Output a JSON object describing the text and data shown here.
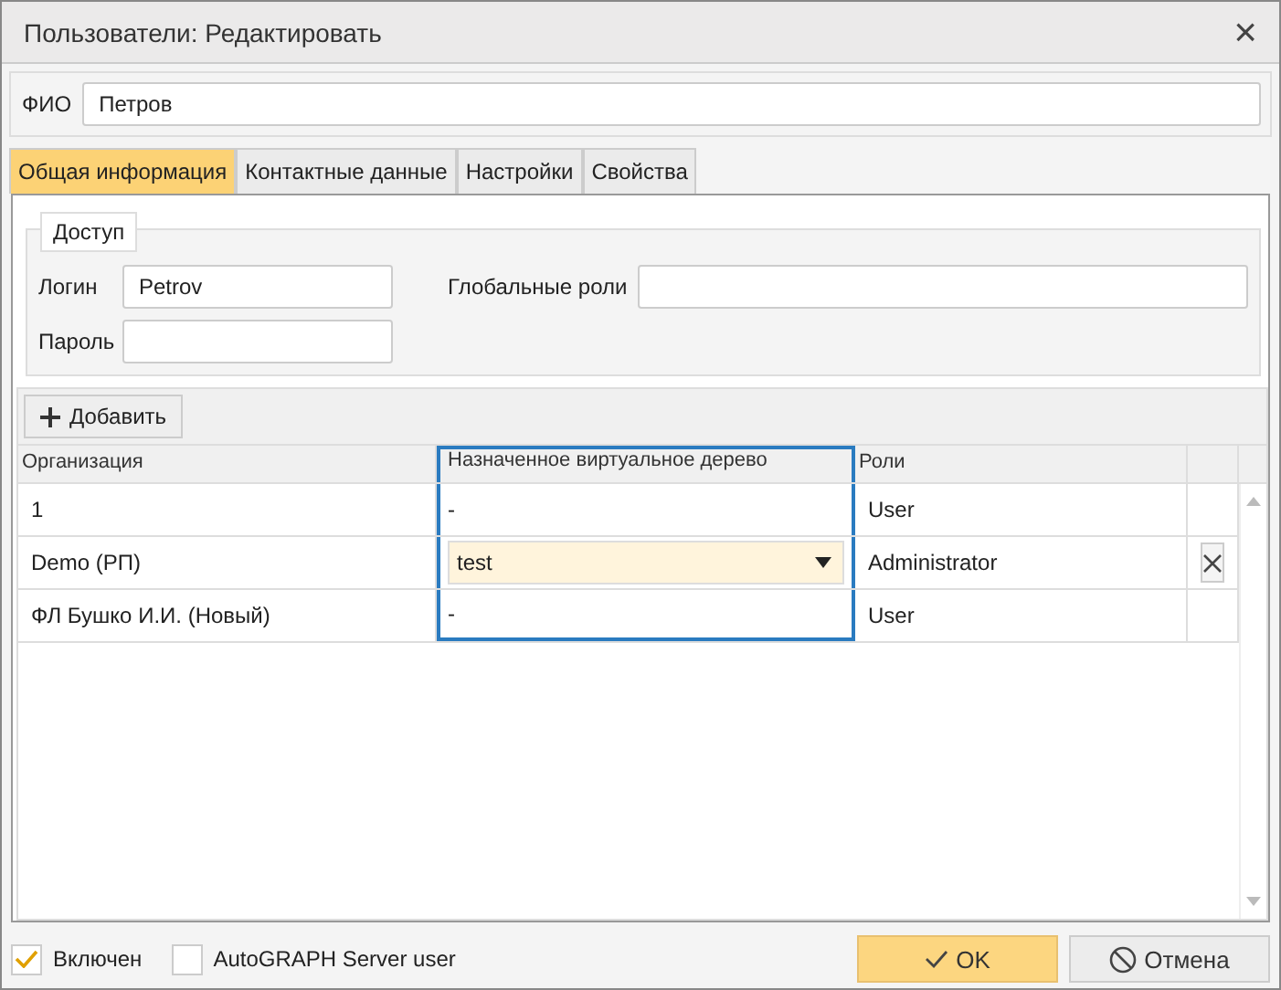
{
  "window": {
    "title": "Пользователи: Редактировать",
    "close": "×"
  },
  "fio": {
    "label": "ФИО",
    "value": "Петров"
  },
  "tabs": [
    {
      "label": "Общая информация",
      "selected": true
    },
    {
      "label": "Контактные данные",
      "selected": false
    },
    {
      "label": "Настройки",
      "selected": false
    },
    {
      "label": "Свойства",
      "selected": false
    }
  ],
  "access": {
    "legend": "Доступ",
    "login_label": "Логин",
    "login": "Petrov",
    "password_label": "Пароль",
    "roles_label": "Глобальные роли"
  },
  "add_button": "Добавить",
  "table": {
    "columns": [
      {
        "label": "Организация",
        "focused": false
      },
      {
        "label": "Назначенное виртуальное дерево",
        "focused": true
      },
      {
        "label": "Роли",
        "focused": false
      }
    ],
    "rows": [
      {
        "org": "1",
        "tree": "-",
        "role": "User",
        "editing": false
      },
      {
        "org": "Demo (РП)",
        "tree": "test",
        "role": "Administrator",
        "editing": true
      },
      {
        "org": "ФЛ Бушко И.И. (Новый)",
        "tree": "-",
        "role": "User",
        "editing": false
      }
    ]
  },
  "footer": {
    "checks": [
      {
        "label": "Включен",
        "checked": true
      },
      {
        "label": "AutoGRAPH Server user",
        "checked": false
      }
    ],
    "ok": "OK",
    "cancel": "Отмена"
  }
}
